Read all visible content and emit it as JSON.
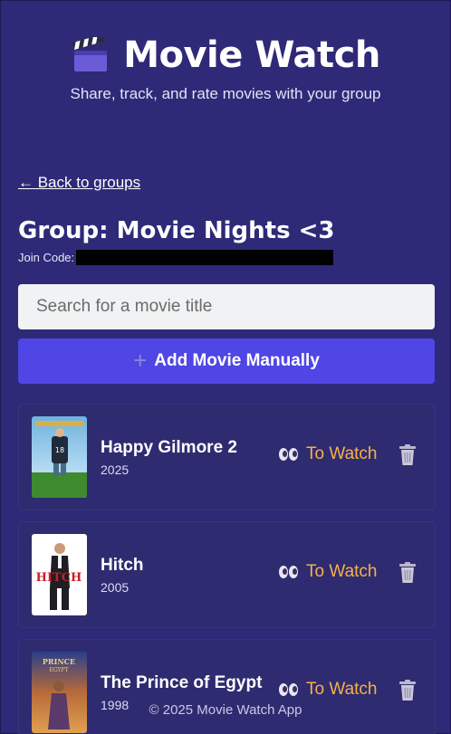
{
  "header": {
    "icon": "clapperboard-icon",
    "title": "Movie Watch",
    "tagline": "Share, track, and rate movies with your group"
  },
  "nav": {
    "back_label": "← Back to groups"
  },
  "group": {
    "title": "Group: Movie Nights <3",
    "join_code_label": "Join Code:"
  },
  "search": {
    "placeholder": "Search for a movie title"
  },
  "add_button": {
    "label": "Add Movie Manually",
    "icon": "plus-icon"
  },
  "movies": [
    {
      "title": "Happy Gilmore 2",
      "year": "2025",
      "status": "To Watch",
      "status_icon": "eyes-icon",
      "delete_icon": "trash-icon"
    },
    {
      "title": "Hitch",
      "year": "2005",
      "status": "To Watch",
      "status_icon": "eyes-icon",
      "delete_icon": "trash-icon"
    },
    {
      "title": "The Prince of Egypt",
      "year": "1998",
      "status": "To Watch",
      "status_icon": "eyes-icon",
      "delete_icon": "trash-icon"
    }
  ],
  "footer": {
    "text": "© 2025 Movie Watch App"
  },
  "colors": {
    "background": "#2e2a78",
    "accent": "#4f46e5",
    "status": "#f5b14a"
  }
}
